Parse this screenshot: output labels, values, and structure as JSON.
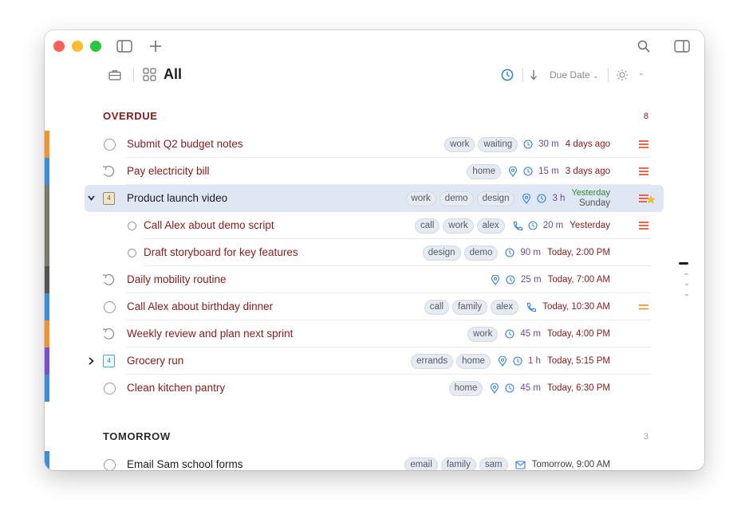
{
  "header": {
    "title": "All",
    "sort_label": "Due Date"
  },
  "sections": {
    "overdue": {
      "title": "OVERDUE",
      "count": "8"
    },
    "tomorrow": {
      "title": "TOMORROW",
      "count": "3"
    }
  },
  "tasks": [
    {
      "title": "Submit Q2 budget notes",
      "tags": [
        "work",
        "waiting"
      ],
      "duration": "30 m",
      "due": "4 days ago"
    },
    {
      "title": "Pay electricity bill",
      "tags": [
        "home"
      ],
      "duration": "15 m",
      "due": "3 days ago"
    },
    {
      "title": "Product launch video",
      "tags": [
        "work",
        "demo",
        "design"
      ],
      "duration": "3 h",
      "due_line1": "Yesterday",
      "due_line2": "Sunday",
      "badge": "4"
    },
    {
      "title": "Call Alex about demo script",
      "tags": [
        "call",
        "work",
        "alex"
      ],
      "duration": "20 m",
      "due": "Yesterday"
    },
    {
      "title": "Draft storyboard for key features",
      "tags": [
        "design",
        "demo"
      ],
      "duration": "90 m",
      "due": "Today, 2:00 PM"
    },
    {
      "title": "Daily mobility routine",
      "tags": [],
      "duration": "25 m",
      "due": "Today, 7:00 AM"
    },
    {
      "title": "Call Alex about birthday dinner",
      "tags": [
        "call",
        "family",
        "alex"
      ],
      "due": "Today, 10:30 AM"
    },
    {
      "title": "Weekly review and plan next sprint",
      "tags": [
        "work"
      ],
      "duration": "45 m",
      "due": "Today, 4:00 PM"
    },
    {
      "title": "Grocery run",
      "tags": [
        "errands",
        "home"
      ],
      "duration": "1 h",
      "due": "Today, 5:15 PM",
      "badge": "4"
    },
    {
      "title": "Clean kitchen pantry",
      "tags": [
        "home"
      ],
      "duration": "45 m",
      "due": "Today, 6:30 PM"
    },
    {
      "title": "Email Sam school forms",
      "tags": [
        "email",
        "family",
        "sam"
      ],
      "due": "Tomorrow, 9:00 AM"
    }
  ],
  "colors": {
    "accent": "#2f7fe8",
    "overdue_text": "#8b1a1a",
    "priority_high": "#e8553a",
    "priority_medium": "#f0963a",
    "selection": "#dfe7f5"
  }
}
